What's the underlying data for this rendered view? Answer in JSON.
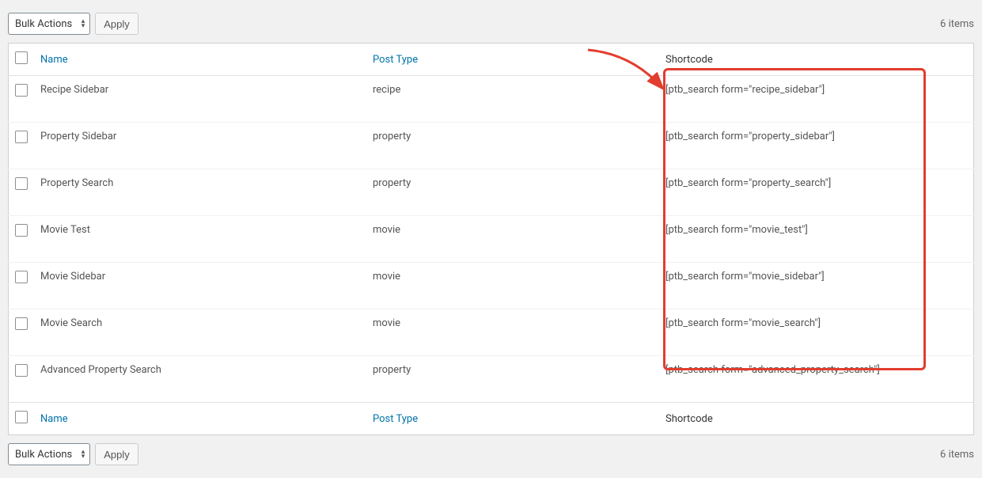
{
  "tablenav": {
    "bulk_actions_label": "Bulk Actions",
    "apply_label": "Apply",
    "items_count": "6 items"
  },
  "columns": {
    "name": "Name",
    "post_type": "Post Type",
    "shortcode": "Shortcode"
  },
  "rows": [
    {
      "name": "Recipe Sidebar",
      "post_type": "recipe",
      "shortcode": "[ptb_search form=\"recipe_sidebar\"]"
    },
    {
      "name": "Property Sidebar",
      "post_type": "property",
      "shortcode": "[ptb_search form=\"property_sidebar\"]"
    },
    {
      "name": "Property Search",
      "post_type": "property",
      "shortcode": "[ptb_search form=\"property_search\"]"
    },
    {
      "name": "Movie Test",
      "post_type": "movie",
      "shortcode": "[ptb_search form=\"movie_test\"]"
    },
    {
      "name": "Movie Sidebar",
      "post_type": "movie",
      "shortcode": "[ptb_search form=\"movie_sidebar\"]"
    },
    {
      "name": "Movie Search",
      "post_type": "movie",
      "shortcode": "[ptb_search form=\"movie_search\"]"
    },
    {
      "name": "Advanced Property Search",
      "post_type": "property",
      "shortcode": "[ptb_search form=\"advanced_property_search\"]"
    }
  ]
}
